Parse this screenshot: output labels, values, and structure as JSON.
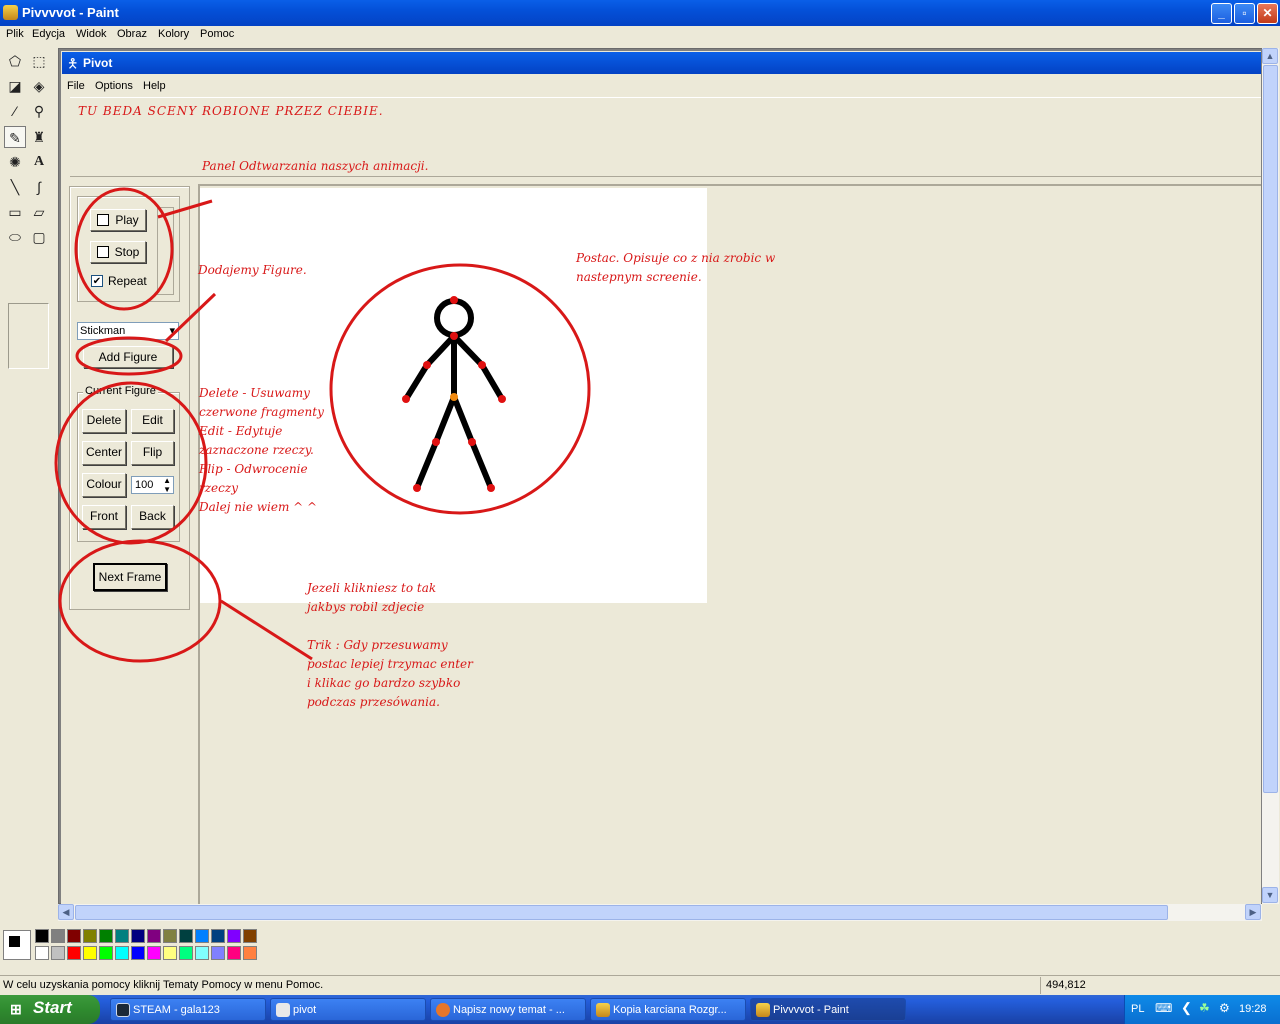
{
  "window": {
    "title": "Pivvvvot - Paint"
  },
  "menu": [
    "Plik",
    "Edycja",
    "Widok",
    "Obraz",
    "Kolory",
    "Pomoc"
  ],
  "pivot": {
    "title": "Pivot",
    "menu": [
      "File",
      "Options",
      "Help"
    ],
    "scenes_note": "TU BEDA SCENY ROBIONE PRZEZ CIEBIE.",
    "play_label": "Play",
    "stop_label": "Stop",
    "repeat_label": "Repeat",
    "repeat_checked": true,
    "figure_type": "Stickman",
    "add_figure_label": "Add Figure",
    "group_label": "Current Figure",
    "delete_label": "Delete",
    "edit_label": "Edit",
    "center_label": "Center",
    "flip_label": "Flip",
    "colour_label": "Colour",
    "colour_value": "100",
    "front_label": "Front",
    "back_label": "Back",
    "next_frame_label": "Next Frame"
  },
  "annotations": {
    "panel": "Panel Odtwarzania naszych animacji.",
    "add_figure": "Dodajemy Figure.",
    "postac_1": "Postac. Opisuje co z nia zrobic w",
    "postac_2": "nastepnym screenie.",
    "delete_lines": [
      "Delete - Usuwamy",
      "czerwone fragmenty",
      "Edit - Edytuje",
      "zaznaczone rzeczy.",
      "Flip - Odwrocenie",
      "rzeczy",
      "Dalej nie wiem  ^ ^"
    ],
    "next_frame_lines": [
      "Jezeli klikniesz to tak",
      "jakbys robil zdjecie"
    ],
    "trick_lines": [
      "Trik : Gdy przesuwamy",
      "postac lepiej trzymac enter",
      "i klikac go bardzo szybko",
      "podczas przesówania."
    ]
  },
  "status": {
    "help_text": "W celu uzyskania pomocy kliknij Tematy Pomocy w menu Pomoc.",
    "coords": "494,812"
  },
  "taskbar": {
    "start_label": "Start",
    "items": [
      {
        "label": "STEAM - gala123",
        "icon": "steam-icon"
      },
      {
        "label": "pivot",
        "icon": "pivot-icon"
      },
      {
        "label": "Napisz nowy temat - ...",
        "icon": "firefox-icon"
      },
      {
        "label": "Kopia karciana Rozgr...",
        "icon": "paint-icon"
      },
      {
        "label": "Pivvvvot - Paint",
        "icon": "paint-icon"
      }
    ],
    "language": "PL",
    "clock": "19:28"
  },
  "colors": {
    "annotation": "#d81818",
    "palette_row1": [
      "#000000",
      "#808080",
      "#800000",
      "#808000",
      "#008000",
      "#008080",
      "#000080",
      "#800080",
      "#808040",
      "#004040",
      "#0080ff",
      "#004080",
      "#8000ff",
      "#804000"
    ],
    "palette_row2": [
      "#ffffff",
      "#c0c0c0",
      "#ff0000",
      "#ffff00",
      "#00ff00",
      "#00ffff",
      "#0000ff",
      "#ff00ff",
      "#ffff80",
      "#00ff80",
      "#80ffff",
      "#8080ff",
      "#ff0080",
      "#ff8040"
    ]
  }
}
